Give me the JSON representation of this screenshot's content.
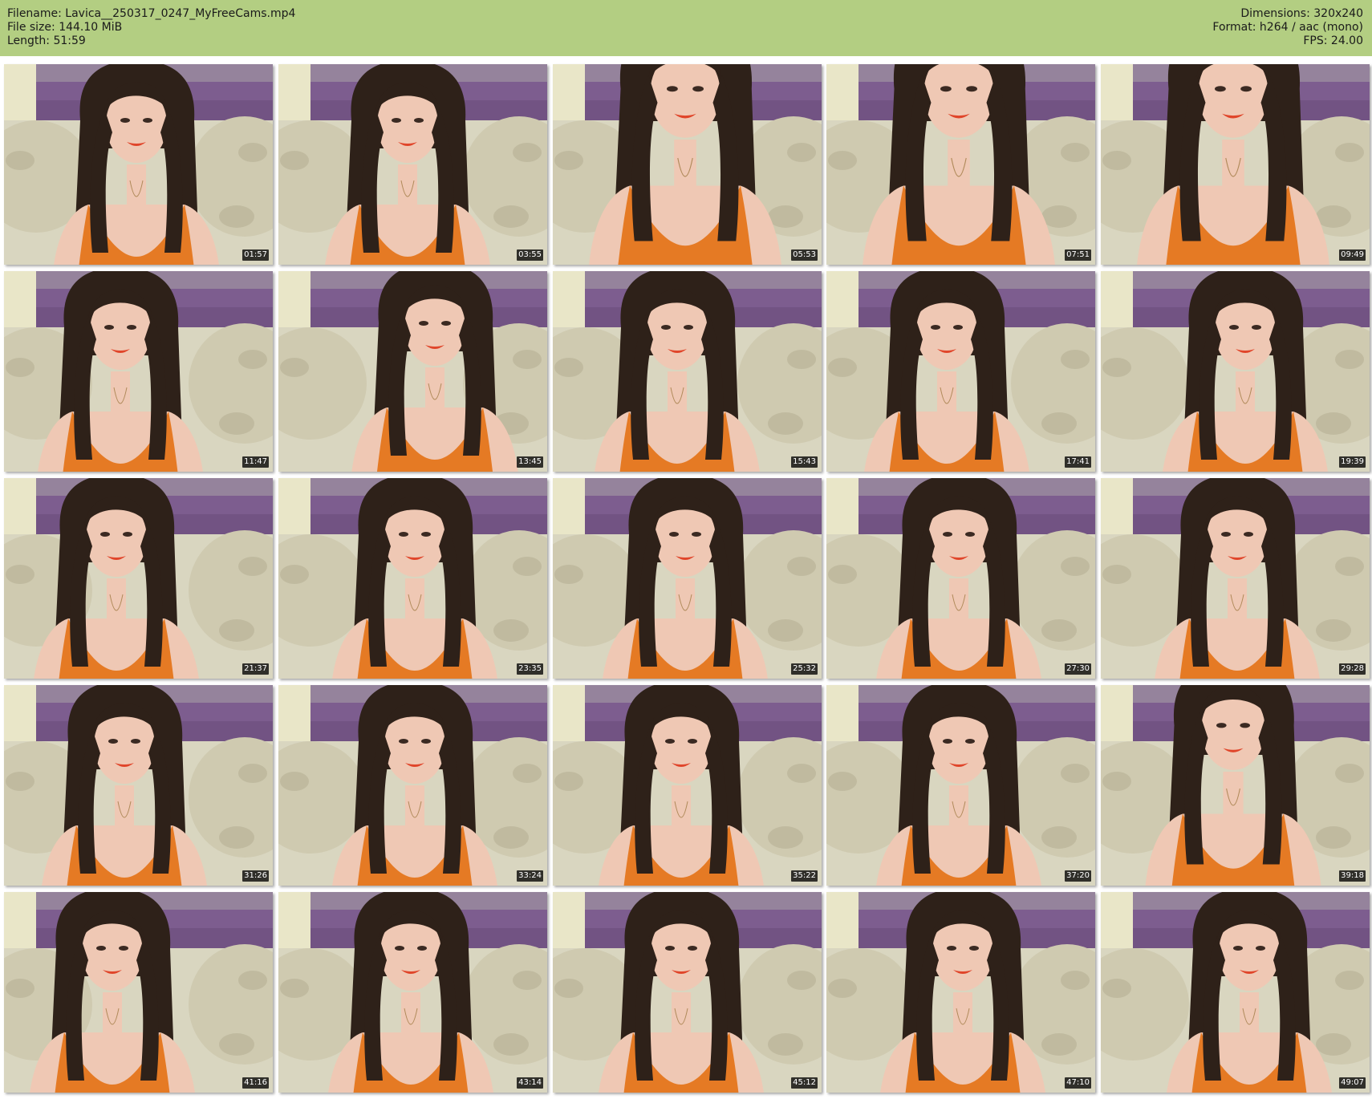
{
  "header": {
    "filename": "Filename: Lavica__250317_0247_MyFreeCams.mp4",
    "filesize": "File size: 144.10 MiB",
    "length": "Length: 51:59",
    "dimensions": "Dimensions: 320x240",
    "format": "Format: h264 / aac (mono)",
    "fps": "FPS: 24.00"
  },
  "colors": {
    "header_bg": "#b3ce82",
    "top": "#e57a24",
    "hair": "#2e2119",
    "skin": "#efc8b4",
    "lavender": "#7d5d8f",
    "cushion": "#d9d6c0",
    "wall": "#e9e6c8"
  },
  "thumbnails": [
    {
      "time": "01:57"
    },
    {
      "time": "03:55"
    },
    {
      "time": "05:53"
    },
    {
      "time": "07:51"
    },
    {
      "time": "09:49"
    },
    {
      "time": "11:47"
    },
    {
      "time": "13:45"
    },
    {
      "time": "15:43"
    },
    {
      "time": "17:41"
    },
    {
      "time": "19:39"
    },
    {
      "time": "21:37"
    },
    {
      "time": "23:35"
    },
    {
      "time": "25:32"
    },
    {
      "time": "27:30"
    },
    {
      "time": "29:28"
    },
    {
      "time": "31:26"
    },
    {
      "time": "33:24"
    },
    {
      "time": "35:22"
    },
    {
      "time": "37:20"
    },
    {
      "time": "39:18"
    },
    {
      "time": "41:16"
    },
    {
      "time": "43:14"
    },
    {
      "time": "45:12"
    },
    {
      "time": "47:10"
    },
    {
      "time": "49:07"
    }
  ]
}
